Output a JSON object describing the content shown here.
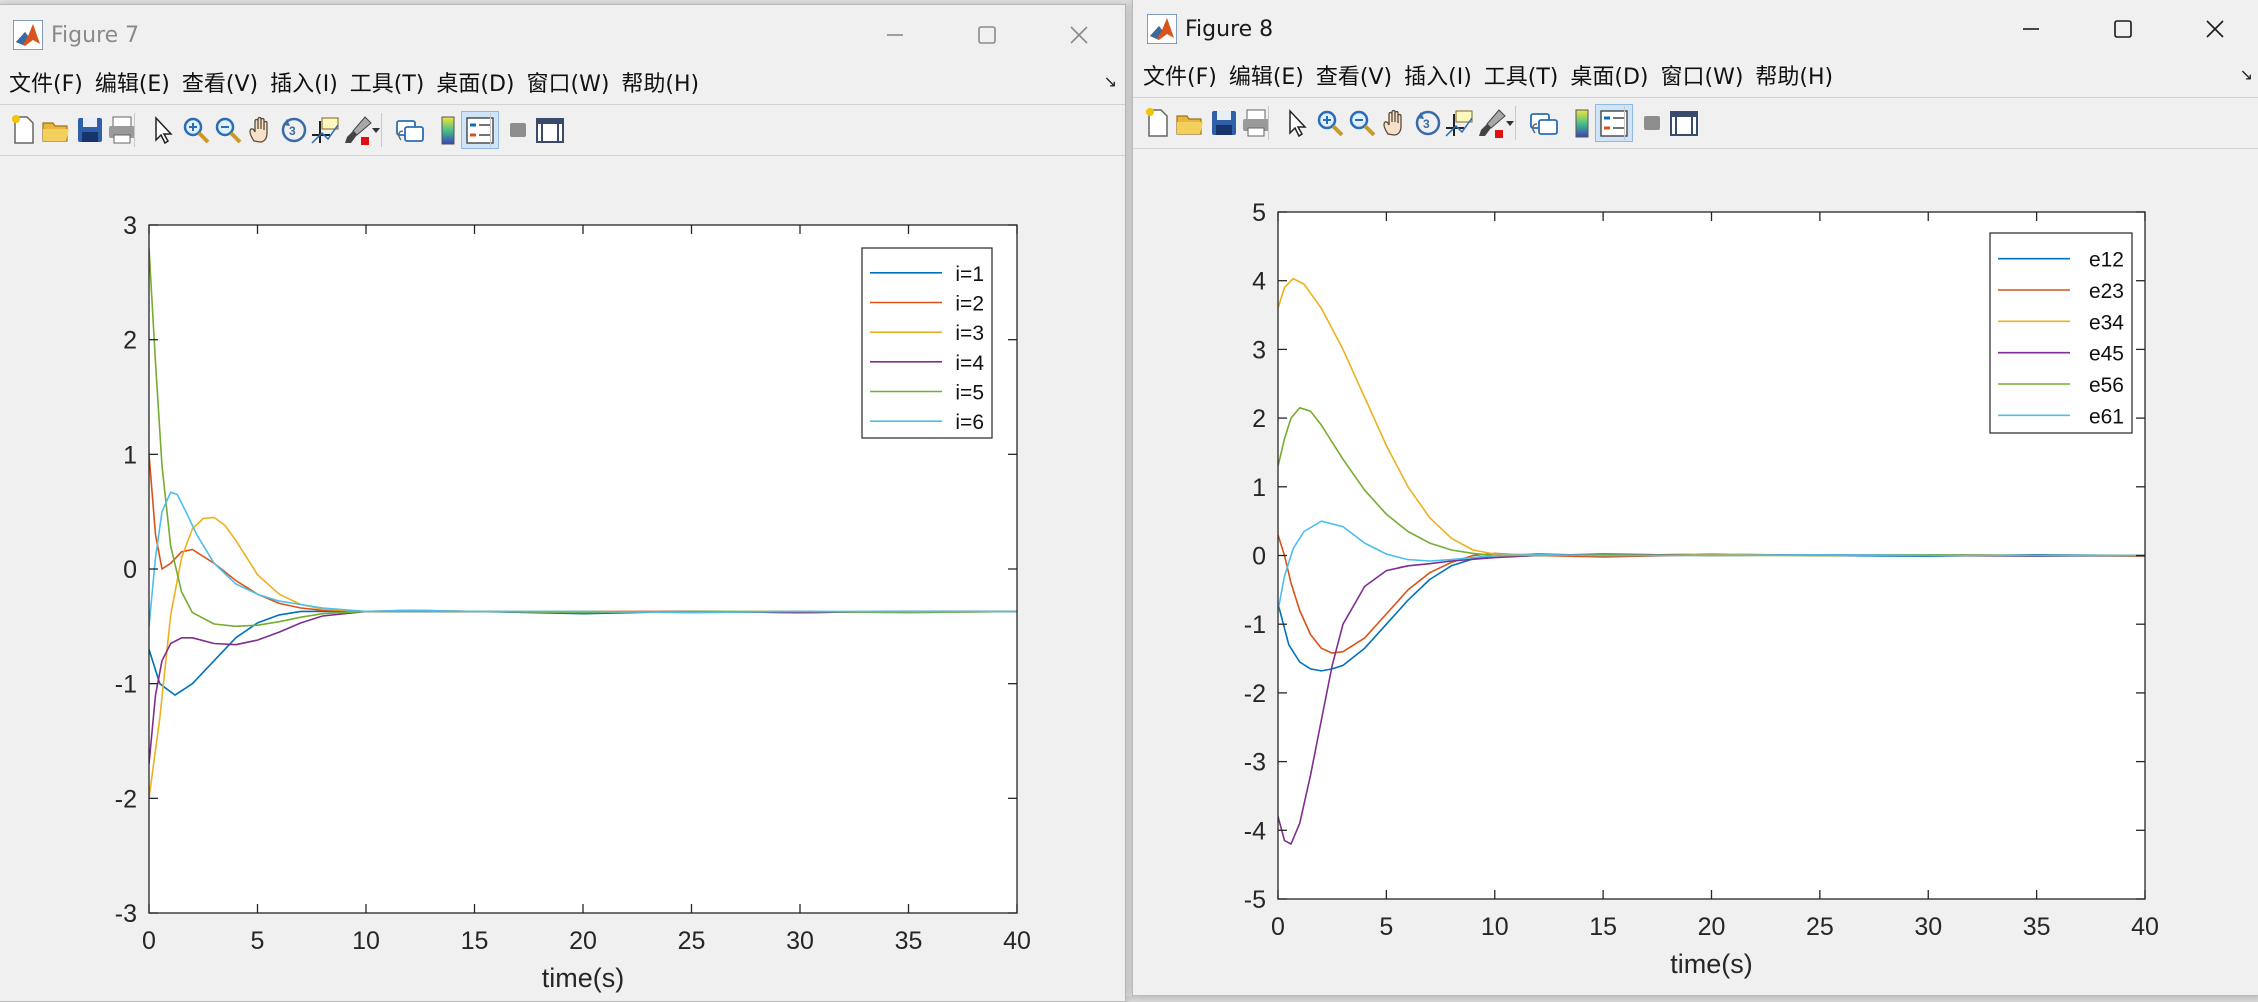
{
  "menu_labels": [
    "文件(F)",
    "编辑(E)",
    "查看(V)",
    "插入(I)",
    "工具(T)",
    "桌面(D)",
    "窗口(W)",
    "帮助(H)"
  ],
  "toolbar_icons": [
    "new-figure-icon",
    "open-file-icon",
    "save-icon",
    "print-icon",
    "pointer-icon",
    "zoom-in-icon",
    "zoom-out-icon",
    "pan-hand-icon",
    "rotate-3d-icon",
    "data-cursor-icon",
    "brush-icon",
    "link-plot-icon",
    "colorbar-icon",
    "legend-icon",
    "hide-plot-tools-icon",
    "show-plot-tools-icon"
  ],
  "colors": {
    "series": [
      "#0072BD",
      "#D95319",
      "#EDB120",
      "#7E2F8E",
      "#77AC30",
      "#4DBEEE"
    ],
    "title_active": "#1a1a1a",
    "title_inactive": "#8a8a8a",
    "matlab_icon_orange": "#d9531e"
  },
  "windows": [
    {
      "title": "Figure 7",
      "active": false,
      "chart_data": {
        "type": "line",
        "xlabel": "time(s)",
        "ylabel": "",
        "xlim": [
          0,
          40
        ],
        "ylim": [
          -3,
          3
        ],
        "xticks": [
          "0",
          "5",
          "10",
          "15",
          "20",
          "25",
          "30",
          "35",
          "40"
        ],
        "yticks": [
          "3",
          "2",
          "1",
          "0",
          "-1",
          "-2",
          "-3"
        ],
        "grid": false,
        "legend_position": "top-right",
        "series": [
          {
            "name": "i=1",
            "x": [
              0,
              0.5,
              1.2,
              2,
              3,
              4,
              5,
              6,
              7,
              8,
              9,
              10,
              12,
              15,
              20,
              25,
              30,
              35,
              40
            ],
            "y": [
              -0.7,
              -1.0,
              -1.1,
              -1.0,
              -0.8,
              -0.6,
              -0.47,
              -0.4,
              -0.37,
              -0.37,
              -0.37,
              -0.37,
              -0.37,
              -0.37,
              -0.39,
              -0.37,
              -0.38,
              -0.37,
              -0.37
            ]
          },
          {
            "name": "i=2",
            "x": [
              0,
              0.3,
              0.6,
              1,
              1.5,
              2,
              3,
              4,
              5,
              6,
              7,
              8,
              10,
              12,
              15,
              20,
              25,
              30,
              35,
              40
            ],
            "y": [
              1.0,
              0.3,
              0.0,
              0.05,
              0.15,
              0.17,
              0.05,
              -0.1,
              -0.22,
              -0.3,
              -0.34,
              -0.36,
              -0.37,
              -0.36,
              -0.37,
              -0.37,
              -0.37,
              -0.38,
              -0.37,
              -0.37
            ]
          },
          {
            "name": "i=3",
            "x": [
              0,
              0.5,
              1,
              1.5,
              2,
              2.5,
              3,
              3.5,
              4,
              5,
              6,
              7,
              8,
              10,
              12,
              15,
              20,
              25,
              30,
              35,
              40
            ],
            "y": [
              -2.0,
              -1.3,
              -0.4,
              0.1,
              0.35,
              0.44,
              0.45,
              0.38,
              0.25,
              -0.05,
              -0.22,
              -0.31,
              -0.35,
              -0.37,
              -0.36,
              -0.37,
              -0.37,
              -0.38,
              -0.37,
              -0.38,
              -0.37
            ]
          },
          {
            "name": "i=4",
            "x": [
              0,
              0.3,
              0.6,
              1,
              1.5,
              2,
              3,
              4,
              5,
              6,
              7,
              8,
              10,
              12,
              15,
              20,
              25,
              30,
              35,
              40
            ],
            "y": [
              -1.7,
              -1.1,
              -0.8,
              -0.65,
              -0.6,
              -0.6,
              -0.65,
              -0.66,
              -0.62,
              -0.55,
              -0.47,
              -0.41,
              -0.37,
              -0.37,
              -0.37,
              -0.38,
              -0.37,
              -0.38,
              -0.37,
              -0.37
            ]
          },
          {
            "name": "i=5",
            "x": [
              0,
              0.3,
              0.6,
              1,
              1.5,
              2,
              3,
              4,
              5,
              6,
              7,
              8,
              10,
              12,
              15,
              20,
              25,
              30,
              35,
              40
            ],
            "y": [
              2.8,
              1.8,
              0.9,
              0.2,
              -0.2,
              -0.38,
              -0.48,
              -0.5,
              -0.49,
              -0.46,
              -0.42,
              -0.39,
              -0.37,
              -0.37,
              -0.37,
              -0.38,
              -0.37,
              -0.37,
              -0.38,
              -0.37
            ]
          },
          {
            "name": "i=6",
            "x": [
              0,
              0.3,
              0.6,
              1,
              1.3,
              1.7,
              2.2,
              3,
              4,
              5,
              6,
              7,
              8,
              10,
              12,
              15,
              20,
              25,
              30,
              35,
              40
            ],
            "y": [
              -0.5,
              0.1,
              0.5,
              0.67,
              0.65,
              0.5,
              0.3,
              0.05,
              -0.13,
              -0.22,
              -0.28,
              -0.31,
              -0.34,
              -0.37,
              -0.36,
              -0.37,
              -0.37,
              -0.38,
              -0.37,
              -0.37,
              -0.37
            ]
          }
        ]
      }
    },
    {
      "title": "Figure 8",
      "active": true,
      "chart_data": {
        "type": "line",
        "xlabel": "time(s)",
        "ylabel": "",
        "xlim": [
          0,
          40
        ],
        "ylim": [
          -5,
          5
        ],
        "xticks": [
          "0",
          "5",
          "10",
          "15",
          "20",
          "25",
          "30",
          "35",
          "40"
        ],
        "yticks": [
          "5",
          "4",
          "3",
          "2",
          "1",
          "0",
          "-1",
          "-2",
          "-3",
          "-4",
          "-5"
        ],
        "grid": false,
        "legend_position": "top-right",
        "series": [
          {
            "name": "e12",
            "x": [
              0,
              0.5,
              1,
              1.5,
              2,
              2.5,
              3,
              4,
              5,
              6,
              7,
              8,
              9,
              10,
              12,
              15,
              20,
              25,
              30,
              35,
              40
            ],
            "y": [
              -0.7,
              -1.3,
              -1.55,
              -1.65,
              -1.68,
              -1.65,
              -1.6,
              -1.35,
              -1.0,
              -0.65,
              -0.35,
              -0.15,
              -0.05,
              0.0,
              0.02,
              0.0,
              0.02,
              0.0,
              -0.01,
              0.01,
              0.0
            ]
          },
          {
            "name": "e23",
            "x": [
              0,
              0.3,
              0.6,
              1,
              1.5,
              2,
              2.5,
              3,
              4,
              5,
              6,
              7,
              8,
              9,
              10,
              12,
              15,
              20,
              25,
              30,
              35,
              40
            ],
            "y": [
              0.3,
              0.0,
              -0.4,
              -0.8,
              -1.15,
              -1.35,
              -1.42,
              -1.4,
              -1.2,
              -0.85,
              -0.5,
              -0.25,
              -0.1,
              0.0,
              0.03,
              0.0,
              -0.02,
              0.01,
              0.0,
              0.01,
              0.0,
              -0.01
            ]
          },
          {
            "name": "e34",
            "x": [
              0,
              0.3,
              0.7,
              1.2,
              2,
              3,
              4,
              5,
              6,
              7,
              8,
              9,
              10,
              12,
              15,
              20,
              25,
              30,
              35,
              40
            ],
            "y": [
              3.6,
              3.9,
              4.03,
              3.95,
              3.6,
              3.0,
              2.3,
              1.6,
              1.0,
              0.55,
              0.25,
              0.08,
              0.02,
              0.01,
              0.0,
              0.02,
              0.0,
              0.01,
              0.0,
              0.0
            ]
          },
          {
            "name": "e45",
            "x": [
              0,
              0.3,
              0.6,
              1,
              1.5,
              2,
              2.5,
              3,
              4,
              5,
              6,
              7,
              8,
              10,
              12,
              15,
              20,
              25,
              30,
              35,
              40
            ],
            "y": [
              -3.8,
              -4.15,
              -4.2,
              -3.9,
              -3.2,
              -2.4,
              -1.6,
              -1.0,
              -0.45,
              -0.22,
              -0.15,
              -0.12,
              -0.08,
              -0.03,
              0.0,
              0.02,
              0.0,
              0.01,
              0.0,
              -0.01,
              0.0
            ]
          },
          {
            "name": "e56",
            "x": [
              0,
              0.3,
              0.6,
              1,
              1.5,
              2,
              3,
              4,
              5,
              6,
              7,
              8,
              9,
              10,
              12,
              15,
              20,
              25,
              30,
              35,
              40
            ],
            "y": [
              1.3,
              1.7,
              2.0,
              2.15,
              2.1,
              1.9,
              1.4,
              0.95,
              0.6,
              0.35,
              0.18,
              0.08,
              0.03,
              0.0,
              0.0,
              0.01,
              0.0,
              0.0,
              0.01,
              0.0,
              0.0
            ]
          },
          {
            "name": "e61",
            "x": [
              0,
              0.3,
              0.7,
              1.2,
              2,
              3,
              4,
              5,
              6,
              7,
              8,
              9,
              10,
              12,
              15,
              20,
              25,
              30,
              35,
              40
            ],
            "y": [
              -0.8,
              -0.3,
              0.1,
              0.35,
              0.5,
              0.42,
              0.18,
              0.02,
              -0.06,
              -0.08,
              -0.06,
              -0.03,
              0.0,
              0.01,
              0.0,
              0.0,
              0.01,
              0.0,
              0.0,
              0.0
            ]
          }
        ]
      }
    }
  ]
}
